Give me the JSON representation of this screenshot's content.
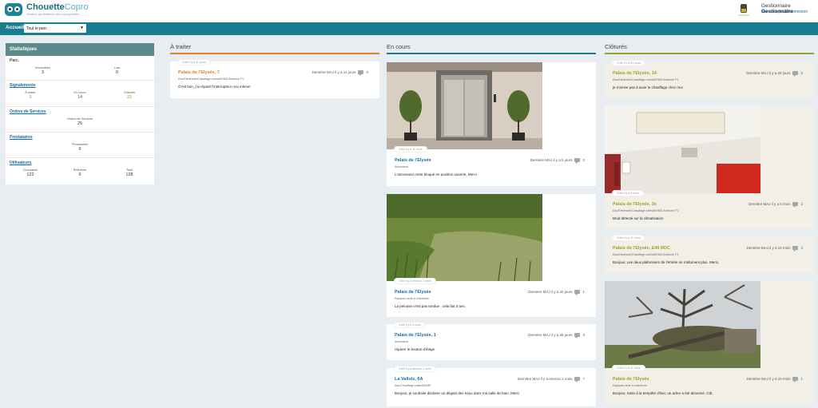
{
  "header": {
    "brand_part1": "Chouette",
    "brand_part2": "Copro",
    "tagline": "Gestion quotidienne des coproprietes",
    "badge_caption": "Gestionnaire",
    "user_role_prefix": "Gestionnaire",
    "user_role_name": "Gestionnaire",
    "link_account": "Mon compte",
    "link_logout": "Déconnexion"
  },
  "nav": {
    "home": "Accueil",
    "select_value": "Tout le parc"
  },
  "stats": {
    "title": "Statistiques",
    "parc": {
      "label": "Parc.",
      "items": [
        {
          "label": "Immeubles",
          "value": "3"
        },
        {
          "label": "Lots",
          "value": "0"
        }
      ]
    },
    "signalements": {
      "label": "Signalements",
      "items": [
        {
          "label": "À traiter",
          "value": "3",
          "color": "#e67e22"
        },
        {
          "label": "En cours",
          "value": "14",
          "color": "#1a6aa3"
        },
        {
          "label": "Clôturés",
          "value": "22",
          "color": "#9aa12b"
        }
      ]
    },
    "ordres": {
      "label": "Ordres de Services",
      "items": [
        {
          "label": "Ordres de Services",
          "value": "25"
        }
      ]
    },
    "prestataires": {
      "label": "Prestataires",
      "items": [
        {
          "label": "Prestataires",
          "value": "6"
        }
      ]
    },
    "utilisateurs": {
      "label": "Utilisateurs",
      "items": [
        {
          "label": "Occupants",
          "value": "122"
        },
        {
          "label": "Référents",
          "value": "6"
        },
        {
          "label": "Total",
          "value": "128"
        }
      ]
    }
  },
  "columns": {
    "a_traiter": {
      "title": "À traiter",
      "accent": "#e67e22"
    },
    "en_cours": {
      "title": "En cours",
      "accent": "#1b7e90"
    },
    "clotures": {
      "title": "Clôturés",
      "accent": "#9aa12b"
    }
  },
  "cards": {
    "t1": {
      "tag": "Créé il y a 11 jours",
      "title": "Palais de l'Elysée, 7",
      "maj": "Dernière MAJ il y a 11 jours",
      "count": "0",
      "category": "Eau/Electricité/Chauffage collectif/VMC/Antenne TV",
      "desc": "C'est bon, j'ai réparé l'interrupteur moi même!"
    },
    "e1": {
      "tag": "Créé il y a 11 mois",
      "title": "Palais de l'Elysée",
      "maj": "Dernière MAJ il y a 5 jours",
      "count": "3",
      "category": "Ascenseur",
      "desc": "L'ascenseur reste bloqué en position ouverte, Merci"
    },
    "e2": {
      "tag": "Créé il y a environ 2 mois",
      "title": "Palais de l'Elysée",
      "maj": "Dernière MAJ il y a 20 jours",
      "count": "1",
      "category": "Espaces verts & extérieurs",
      "desc": "La pelouse n'est pas tondue : cela fait 3 ans."
    },
    "e3": {
      "tag": "Créé il y a 4 mois",
      "title": "Palais de l'Elysée, 1",
      "maj": "Dernière MAJ il y a 28 jours",
      "count": "3",
      "category": "Ascenseur",
      "desc": "réparer le bouton d'étage"
    },
    "e4": {
      "tag": "Créé il y a environ 2 mois",
      "title": "La Vallois, 6A",
      "maj": "Dernière MAJ il y a environ 2 mois",
      "count": "7",
      "category": "Eau/Chauffage collectif/VMC",
      "desc": "Bonjour, je souhaite déclarer un dégats des eaux dans ma salle de bain. Merci"
    },
    "c1": {
      "tag": "Créé il y a 29 jours",
      "title": "Palais de l'Elysée, 14",
      "maj": "Dernière MAJ il y a 29 jours",
      "count": "0",
      "category": "Eau/Electricité/Chauffage collectif/VMC/Antenne TV",
      "desc": "je n'arrive pas à avoir le chauffage chez moi"
    },
    "c2": {
      "tag": "Créé il y a 5 mois",
      "title": "Palais de l'Elysée, 3e",
      "maj": "Dernière MAJ il y a 5 mois",
      "count": "2",
      "category": "Eau/Electricité/Chauffage collectif/VMC/Antenne TV",
      "desc": "Bruit détecté sur la climatisation"
    },
    "c3": {
      "tag": "Créé il y a 11 mois",
      "title": "Palais de l'Elysée, E40 RDC",
      "maj": "Dernière MAJ il y a 10 mois",
      "count": "4",
      "category": "Eau/Electricité/Chauffage collectif/VMC/Antenne TV",
      "desc": "Bonjour, Les deux plafonniers de l'entrée ne s'allument plus. Merci,"
    },
    "c4": {
      "tag": "Créé il y a 11 mois",
      "title": "Palais de l'Elysée",
      "maj": "Dernière MAJ il y a 10 mois",
      "count": "1",
      "category": "Espaces verts & extérieurs",
      "desc": "Bonjour, Suite à la tempête d'hier, un arbre a été déraciné. Cdt,"
    }
  }
}
